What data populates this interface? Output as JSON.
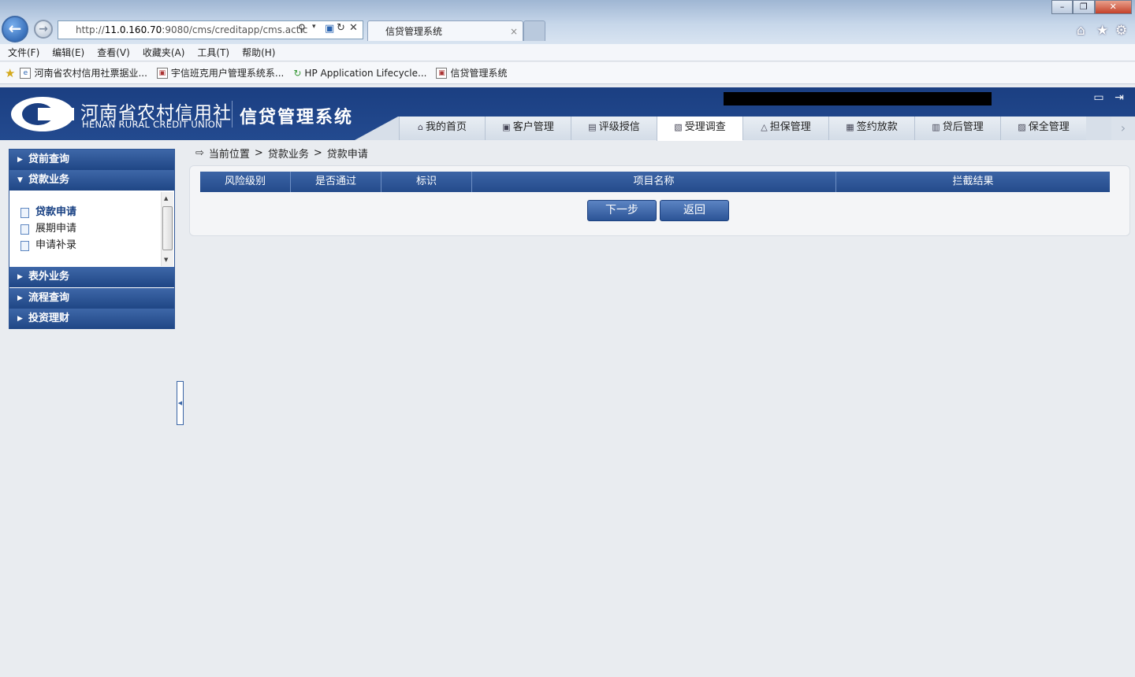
{
  "browser": {
    "url_prefix": "http://",
    "url_host": "11.0.160.70",
    "url_rest": ":9080/cms/creditapp/cms.actic",
    "tab_title": "信贷管理系统",
    "menu": [
      "文件(F)",
      "编辑(E)",
      "查看(V)",
      "收藏夹(A)",
      "工具(T)",
      "帮助(H)"
    ],
    "favorites": [
      "河南省农村信用社票据业...",
      "宇信班克用户管理系统系...",
      "HP Application Lifecycle...",
      "信贷管理系统"
    ]
  },
  "header": {
    "org_cn": "河南省农村信用社",
    "org_en": "HENAN RURAL CREDIT UNION",
    "system_name": "信贷管理系统"
  },
  "topnav": {
    "items": [
      "我的首页",
      "客户管理",
      "评级授信",
      "受理调查",
      "担保管理",
      "签约放款",
      "贷后管理",
      "保全管理"
    ],
    "active": "受理调查"
  },
  "sidebar": {
    "groups": [
      "贷前查询",
      "贷款业务",
      "表外业务",
      "流程查询",
      "投资理财"
    ],
    "expanded": "贷款业务",
    "items": [
      "贷款申请",
      "展期申请",
      "申请补录"
    ],
    "active_item": "贷款申请"
  },
  "breadcrumb": {
    "label": "当前位置",
    "sep": ">",
    "level1": "贷款业务",
    "level2": "贷款申请"
  },
  "table": {
    "columns": [
      "风险级别",
      "是否通过",
      "标识",
      "项目名称",
      "拦截结果"
    ]
  },
  "buttons": {
    "next": "下一步",
    "back": "返回"
  },
  "colors": {
    "header_blue": "#1b3f82",
    "grid_blue": "#2f5797"
  }
}
